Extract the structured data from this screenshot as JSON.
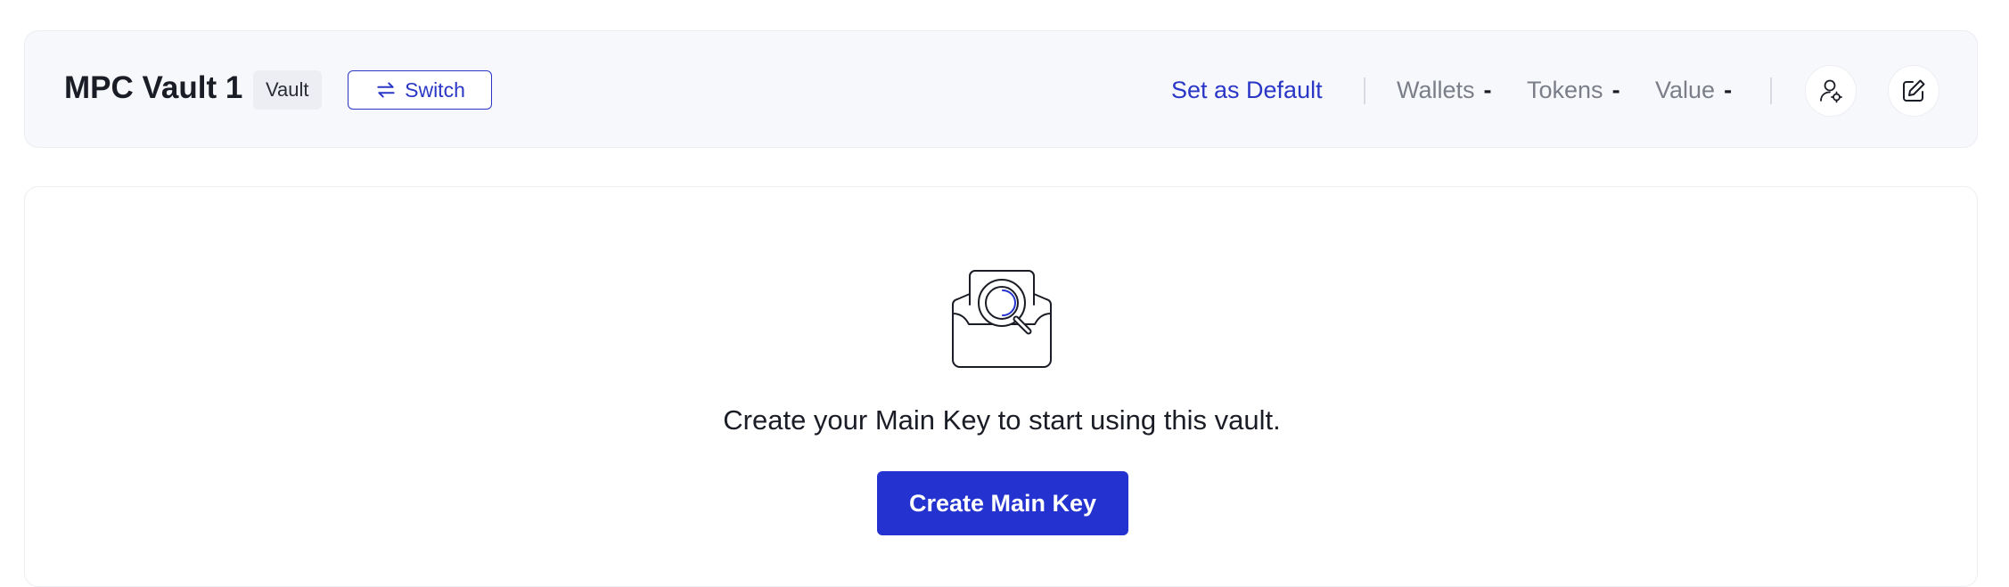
{
  "header": {
    "vault_name": "MPC Vault 1",
    "badge": "Vault",
    "switch_label": "Switch",
    "set_default_label": "Set as Default",
    "stats": [
      {
        "label": "Wallets",
        "value": "-"
      },
      {
        "label": "Tokens",
        "value": "-"
      },
      {
        "label": "Value",
        "value": "-"
      }
    ],
    "icons": [
      "swap-arrows-icon",
      "user-key-icon",
      "edit-icon"
    ]
  },
  "empty_state": {
    "illustration": "inbox-search-illustration",
    "message": "Create your Main Key to start using this vault.",
    "cta_label": "Create Main Key"
  },
  "colors": {
    "accent": "#2433cf",
    "header_bg": "#f7f8fb",
    "muted_text": "#7b7e88"
  }
}
